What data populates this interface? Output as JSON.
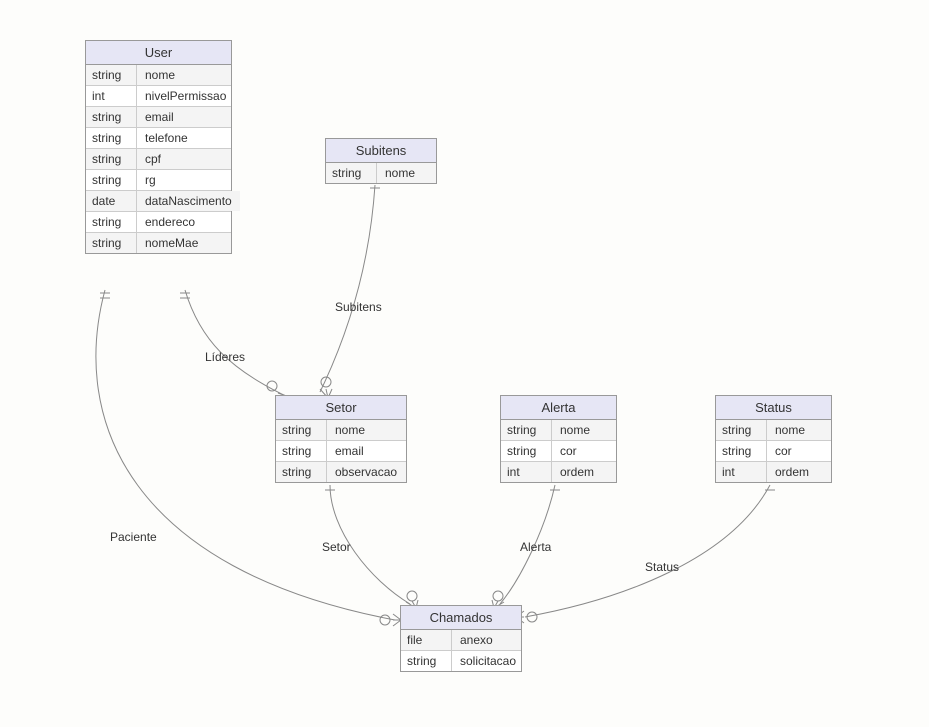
{
  "entities": {
    "user": {
      "title": "User",
      "fields": [
        {
          "type": "string",
          "name": "nome"
        },
        {
          "type": "int",
          "name": "nivelPermissao"
        },
        {
          "type": "string",
          "name": "email"
        },
        {
          "type": "string",
          "name": "telefone"
        },
        {
          "type": "string",
          "name": "cpf"
        },
        {
          "type": "string",
          "name": "rg"
        },
        {
          "type": "date",
          "name": "dataNascimento"
        },
        {
          "type": "string",
          "name": "endereco"
        },
        {
          "type": "string",
          "name": "nomeMae"
        }
      ]
    },
    "subitens": {
      "title": "Subitens",
      "fields": [
        {
          "type": "string",
          "name": "nome"
        }
      ]
    },
    "setor": {
      "title": "Setor",
      "fields": [
        {
          "type": "string",
          "name": "nome"
        },
        {
          "type": "string",
          "name": "email"
        },
        {
          "type": "string",
          "name": "observacao"
        }
      ]
    },
    "alerta": {
      "title": "Alerta",
      "fields": [
        {
          "type": "string",
          "name": "nome"
        },
        {
          "type": "string",
          "name": "cor"
        },
        {
          "type": "int",
          "name": "ordem"
        }
      ]
    },
    "status": {
      "title": "Status",
      "fields": [
        {
          "type": "string",
          "name": "nome"
        },
        {
          "type": "string",
          "name": "cor"
        },
        {
          "type": "int",
          "name": "ordem"
        }
      ]
    },
    "chamados": {
      "title": "Chamados",
      "fields": [
        {
          "type": "file",
          "name": "anexo"
        },
        {
          "type": "string",
          "name": "solicitacao"
        }
      ]
    }
  },
  "relationships": {
    "paciente": "Paciente",
    "lideres": "Líderes",
    "subitens": "Subitens",
    "setor": "Setor",
    "alerta": "Alerta",
    "status": "Status"
  }
}
